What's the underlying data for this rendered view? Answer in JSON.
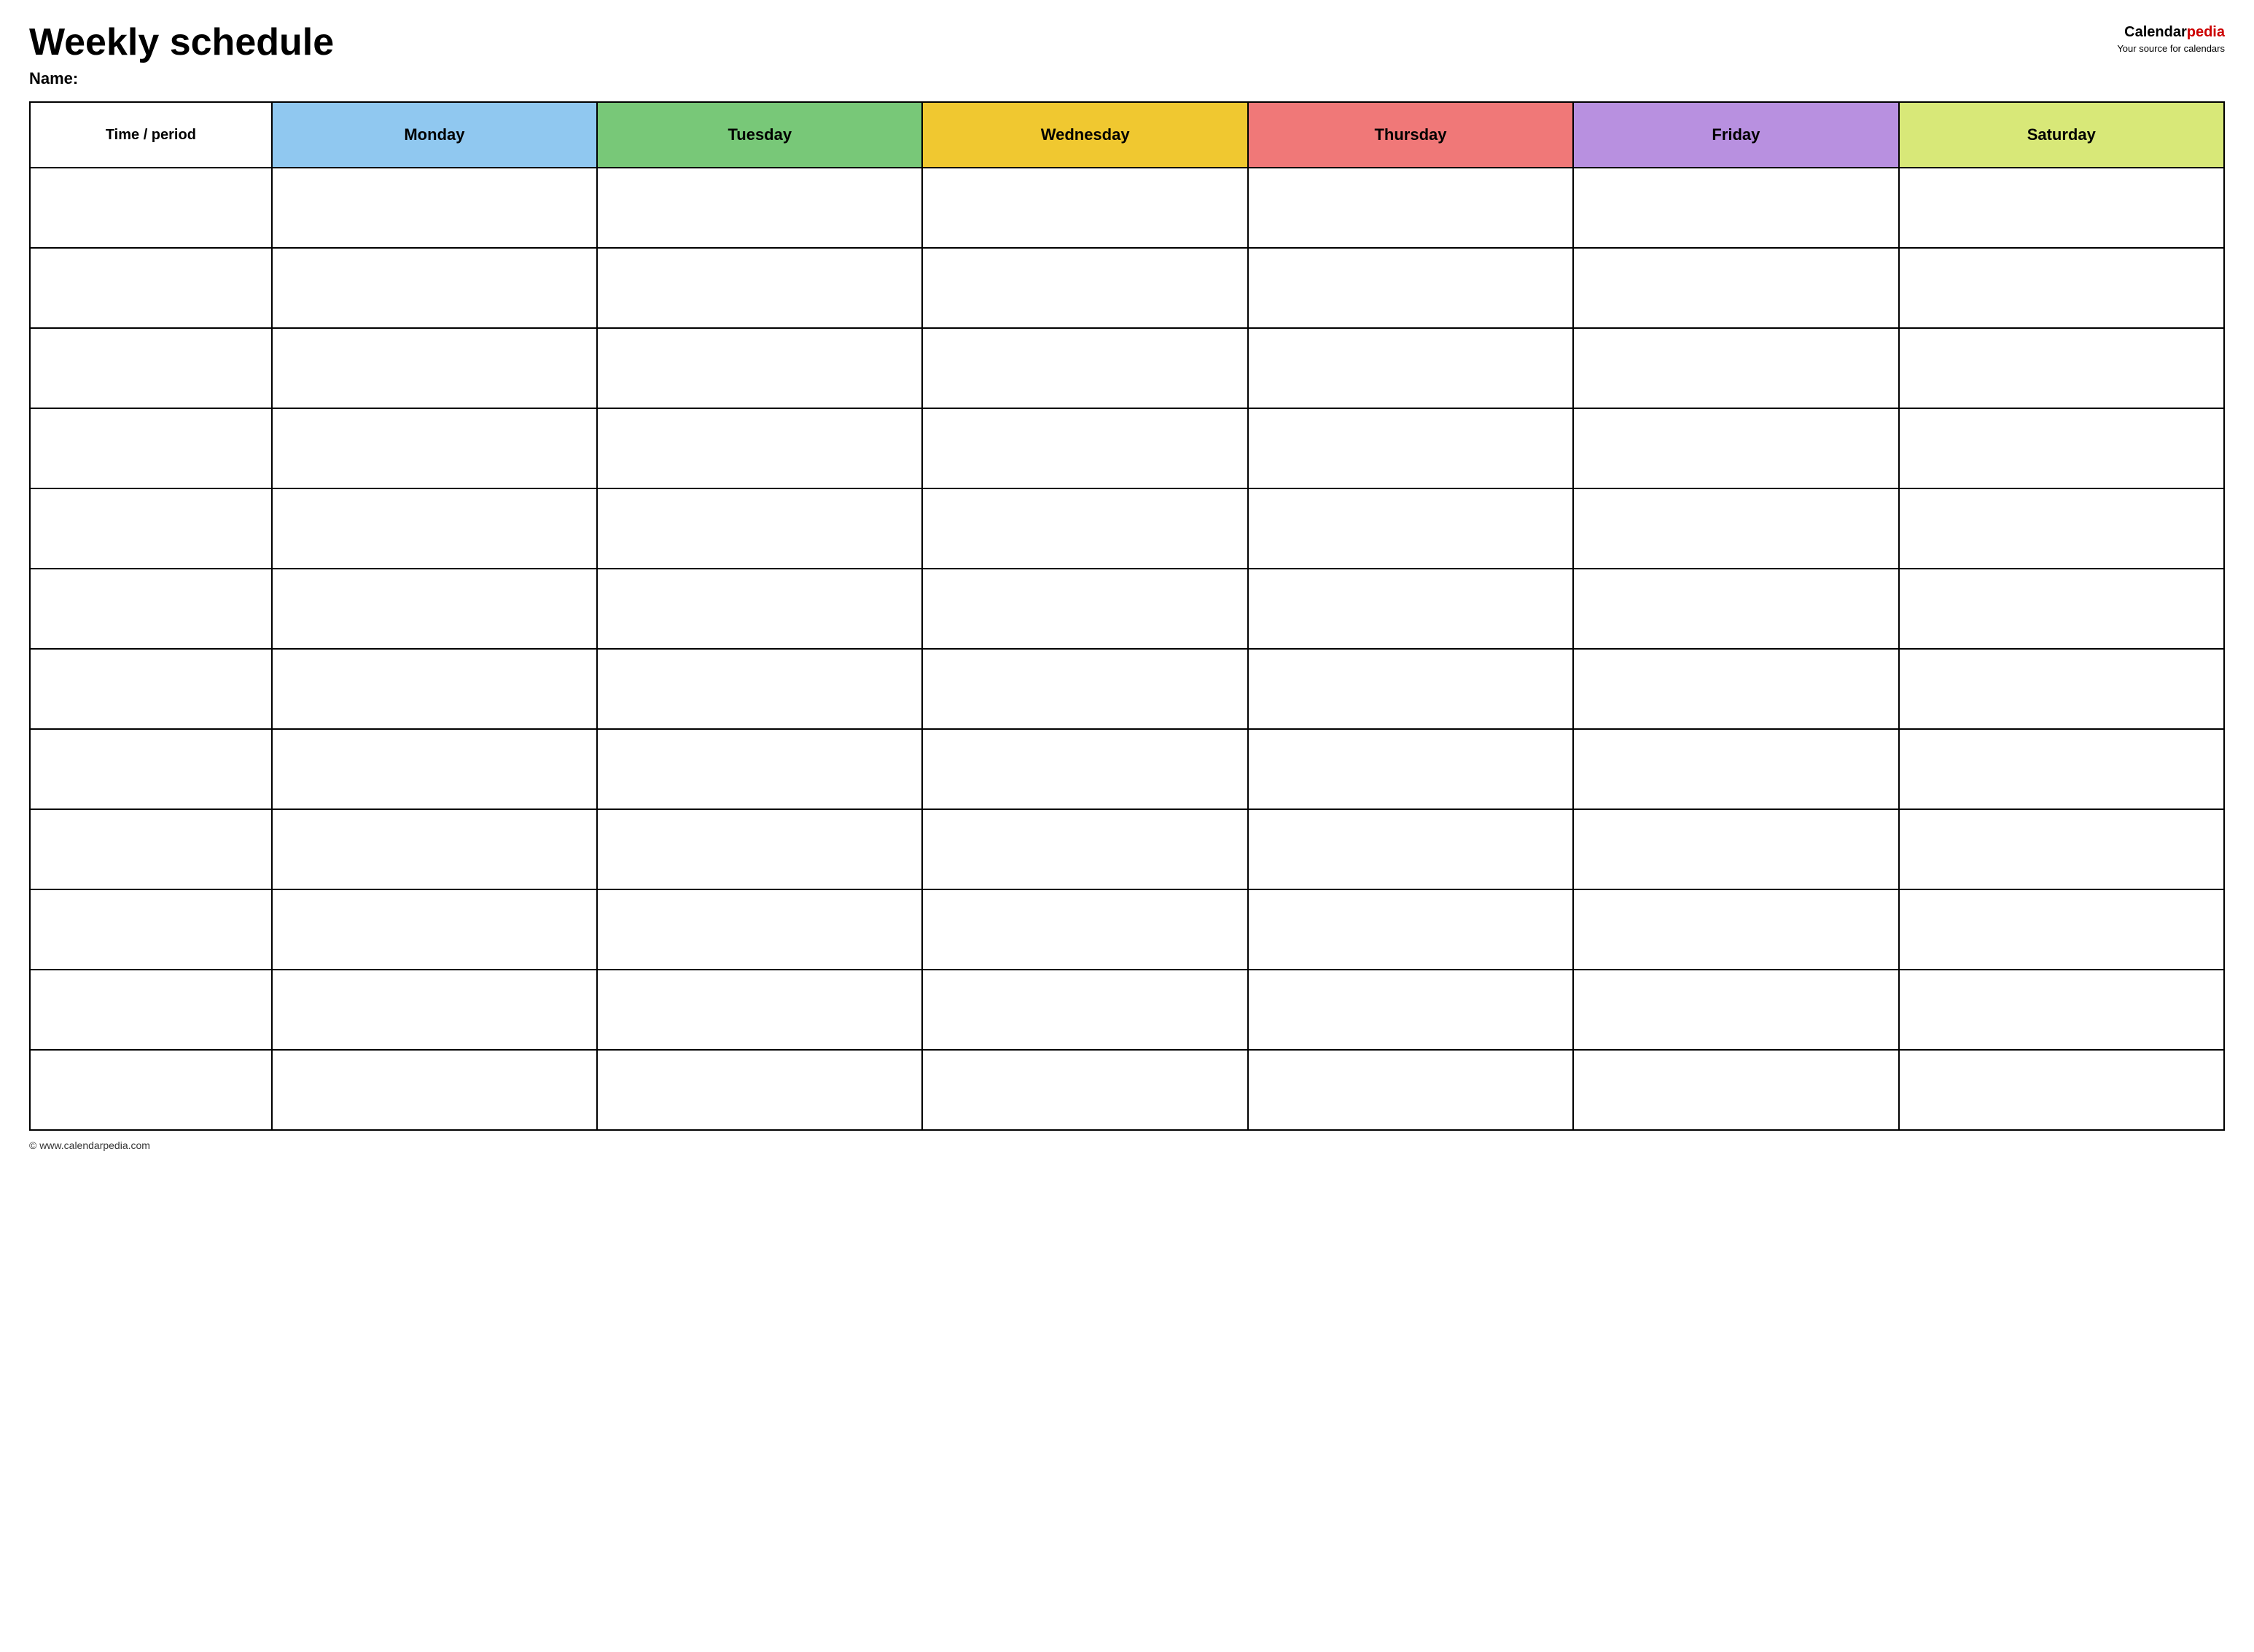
{
  "header": {
    "title": "Weekly schedule",
    "name_label": "Name:",
    "logo_calendar": "Calendar",
    "logo_pedia": "pedia",
    "logo_tagline": "Your source for calendars"
  },
  "table": {
    "columns": [
      {
        "key": "time",
        "label": "Time / period",
        "class": "col-time",
        "header_class": "col-time"
      },
      {
        "key": "monday",
        "label": "Monday",
        "class": "col-day",
        "header_class": "monday"
      },
      {
        "key": "tuesday",
        "label": "Tuesday",
        "class": "col-day",
        "header_class": "tuesday"
      },
      {
        "key": "wednesday",
        "label": "Wednesday",
        "class": "col-day",
        "header_class": "wednesday"
      },
      {
        "key": "thursday",
        "label": "Thursday",
        "class": "col-day",
        "header_class": "thursday"
      },
      {
        "key": "friday",
        "label": "Friday",
        "class": "col-day",
        "header_class": "friday"
      },
      {
        "key": "saturday",
        "label": "Saturday",
        "class": "col-day",
        "header_class": "saturday"
      }
    ],
    "row_count": 12
  },
  "footer": {
    "url": "© www.calendarpedia.com"
  }
}
